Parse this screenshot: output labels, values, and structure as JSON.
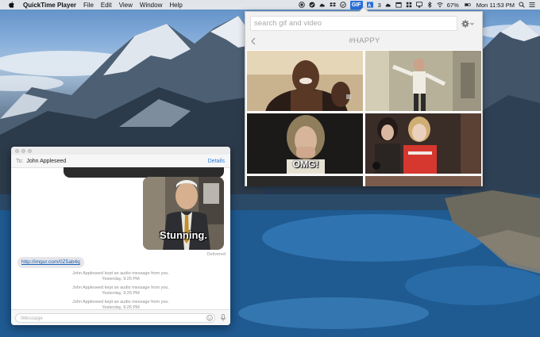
{
  "menubar": {
    "app_name": "QuickTime Player",
    "menus": [
      "File",
      "Edit",
      "View",
      "Window",
      "Help"
    ],
    "status": {
      "gif_label": "GIF",
      "notification_count": "3",
      "battery": "67%",
      "clock": "Mon 11:53 PM"
    }
  },
  "gif_panel": {
    "search_placeholder": "search gif and video",
    "tag": "#HAPPY",
    "caption_omg": "OMG!"
  },
  "messages": {
    "to_label": "To:",
    "recipient": "John Appleseed",
    "details_label": "Details",
    "image_caption": "Stunning.",
    "delivered_label": "Delivered",
    "link_text": "http://imgur.com/0Z5ab4q",
    "audio_notes": [
      {
        "line1": "John Appleseed kept an audio message from you.",
        "line2": "Yesterday, 9:25 PM"
      },
      {
        "line1": "John Appleseed kept an audio message from you.",
        "line2": "Yesterday, 9:25 PM"
      },
      {
        "line1": "John Appleseed kept an audio message from you.",
        "line2": "Yesterday, 9:25 PM"
      }
    ],
    "input_placeholder": "iMessage"
  },
  "colors": {
    "accent_blue": "#2b7de1",
    "gif_badge": "#2a6dd9",
    "bubble_gray": "#e5e5ea"
  }
}
